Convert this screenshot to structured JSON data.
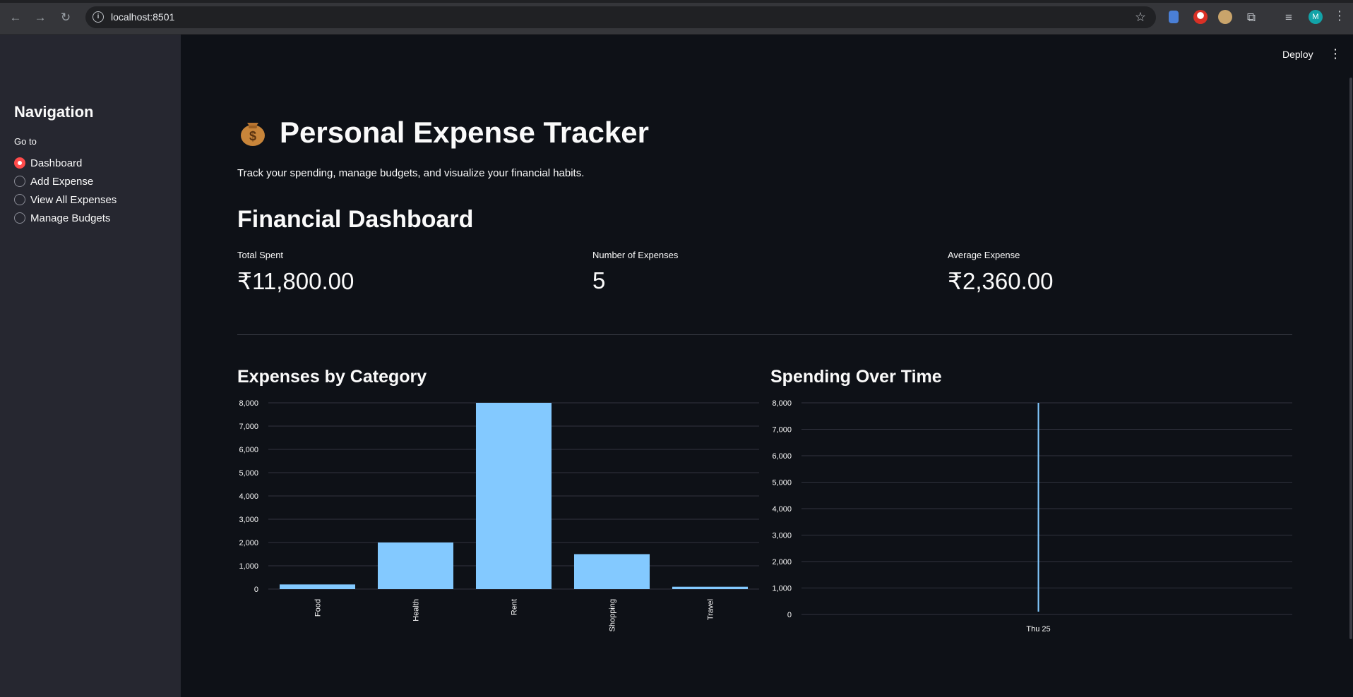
{
  "browser": {
    "url": "localhost:8501",
    "avatar_letter": "M"
  },
  "header": {
    "deploy_label": "Deploy"
  },
  "sidebar": {
    "title": "Navigation",
    "radio_label": "Go to",
    "items": [
      {
        "label": "Dashboard",
        "selected": true
      },
      {
        "label": "Add Expense",
        "selected": false
      },
      {
        "label": "View All Expenses",
        "selected": false
      },
      {
        "label": "Manage Budgets",
        "selected": false
      }
    ]
  },
  "main": {
    "title": "Personal Expense Tracker",
    "title_emoji": "money-bag-icon",
    "subtitle": "Track your spending, manage budgets, and visualize your financial habits.",
    "section_title": "Financial Dashboard",
    "metrics": [
      {
        "label": "Total Spent",
        "value": "₹11,800.00"
      },
      {
        "label": "Number of Expenses",
        "value": "5"
      },
      {
        "label": "Average Expense",
        "value": "₹2,360.00"
      }
    ]
  },
  "colors": {
    "accent": "#ff4b4b",
    "bar": "#83c9ff",
    "background": "#0e1117",
    "sidebar": "#262730"
  },
  "chart_data": [
    {
      "type": "bar",
      "title": "Expenses by Category",
      "categories": [
        "Food",
        "Health",
        "Rent",
        "Shopping",
        "Travel"
      ],
      "values": [
        200,
        2000,
        8000,
        1500,
        100
      ],
      "yticks": [
        "0",
        "1,000",
        "2,000",
        "3,000",
        "4,000",
        "5,000",
        "6,000",
        "7,000",
        "8,000"
      ],
      "ylim": [
        0,
        8000
      ],
      "grid": true
    },
    {
      "type": "line",
      "title": "Spending Over Time",
      "x": [
        "Thu 25"
      ],
      "values": [
        8000
      ],
      "yticks": [
        "0",
        "1,000",
        "2,000",
        "3,000",
        "4,000",
        "5,000",
        "6,000",
        "7,000",
        "8,000"
      ],
      "ylim": [
        0,
        8000
      ],
      "grid": true
    }
  ]
}
